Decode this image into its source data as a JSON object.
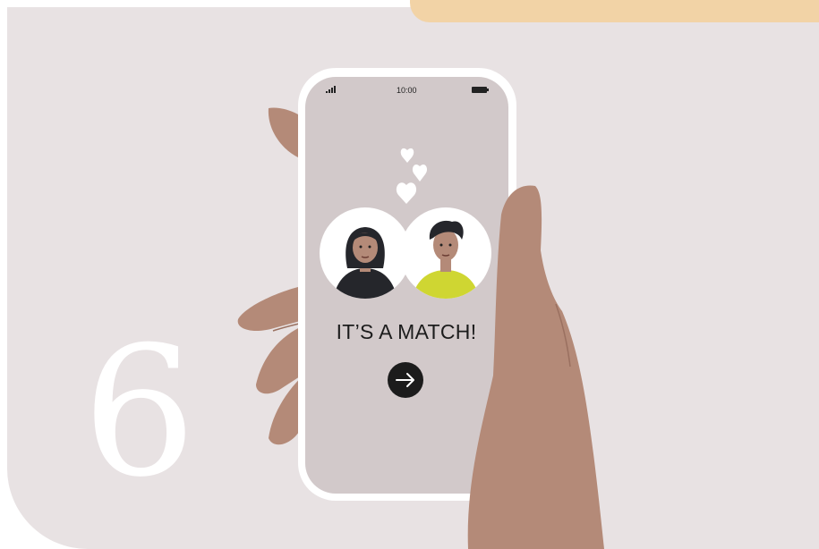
{
  "step_number": "6",
  "phone": {
    "time": "10:00",
    "headline": "IT’S A MATCH!",
    "next_button": {
      "icon": "arrow-right-icon"
    }
  },
  "profiles": [
    {
      "name": "woman-avatar",
      "shirt_color": "#25262b"
    },
    {
      "name": "man-avatar",
      "shirt_color": "#cfd632"
    }
  ],
  "colors": {
    "background": "#e8e2e3",
    "tab": "#f2d3a6",
    "screen": "#d2c9ca",
    "skin": "#b48a78",
    "button": "#1c1c1c"
  }
}
